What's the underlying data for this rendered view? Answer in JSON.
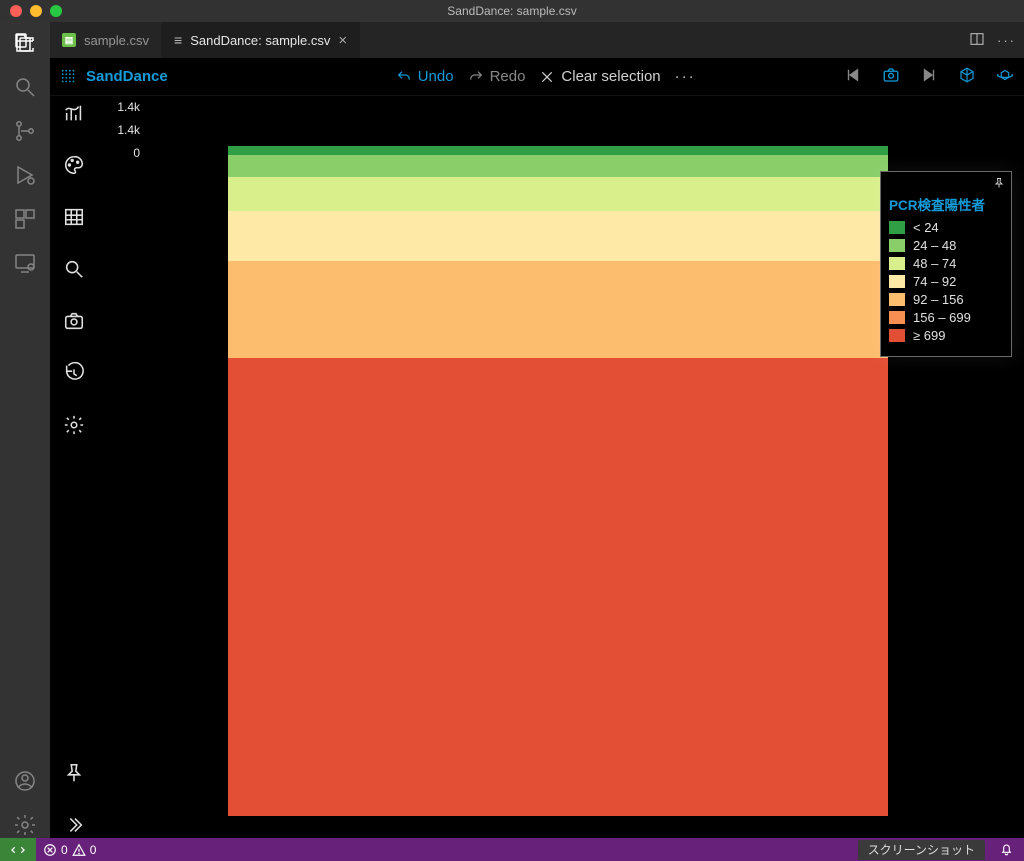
{
  "window_title": "SandDance: sample.csv",
  "tabs": [
    {
      "label": "sample.csv",
      "active": false
    },
    {
      "label": "SandDance: sample.csv",
      "active": true
    }
  ],
  "sanddance": {
    "brand": "SandDance",
    "toolbar": {
      "undo": "Undo",
      "redo": "Redo",
      "clear": "Clear selection"
    },
    "axis_ticks": [
      "1.4k",
      "1.4k",
      "0"
    ],
    "legend": {
      "title": "PCR検査陽性者",
      "items": [
        {
          "label": "< 24",
          "color": "#2f9e44"
        },
        {
          "label": "24 – 48",
          "color": "#8ace6a"
        },
        {
          "label": "48 – 74",
          "color": "#d9ef8b"
        },
        {
          "label": "74 – 92",
          "color": "#fee9a6"
        },
        {
          "label": "92 – 156",
          "color": "#fdbd6e"
        },
        {
          "label": "156 – 699",
          "color": "#f78e52"
        },
        {
          "label": "≥ 699",
          "color": "#e24f35"
        }
      ]
    }
  },
  "status": {
    "errors": "0",
    "warnings": "0",
    "screenshot": "スクリーンショット"
  },
  "chart_data": {
    "type": "bar",
    "orientation": "stacked-horizontal-bands",
    "title": "",
    "ylabel": "",
    "ylim": [
      0,
      1400
    ],
    "color_field": "PCR検査陽性者",
    "bands": [
      {
        "bin": "< 24",
        "color": "#2f9e44",
        "proportion": 0.014
      },
      {
        "bin": "24 – 48",
        "color": "#8ace6a",
        "proportion": 0.033
      },
      {
        "bin": "48 – 74",
        "color": "#d9ef8b",
        "proportion": 0.05
      },
      {
        "bin": "74 – 92",
        "color": "#fee9a6",
        "proportion": 0.074
      },
      {
        "bin": "92 – 156",
        "color": "#fdbd6e",
        "proportion": 0.145
      },
      {
        "bin": "156 – 699",
        "color": "#f78e52",
        "proportion": 0.0
      },
      {
        "bin": "≥ 699",
        "color": "#e24f35",
        "proportion": 0.684
      }
    ]
  }
}
